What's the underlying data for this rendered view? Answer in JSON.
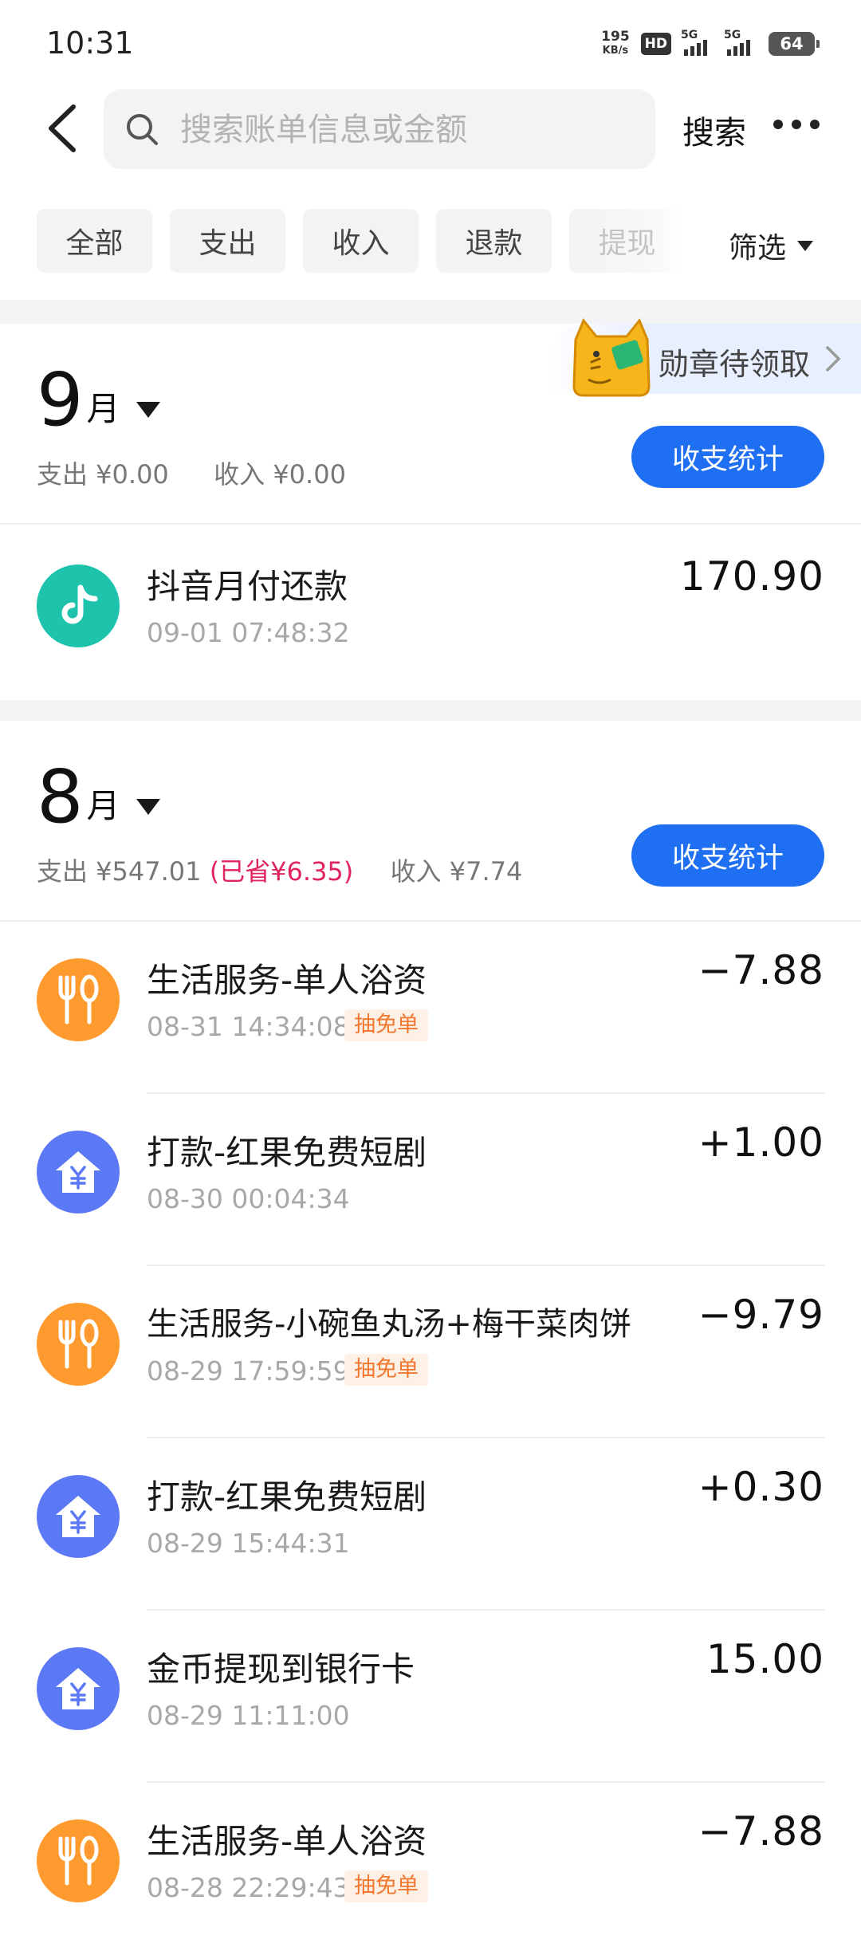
{
  "status_bar": {
    "time": "10:31",
    "net_speed_value": "195",
    "net_speed_unit": "KB/s",
    "hd_label": "HD",
    "sim1_label": "5G",
    "sim2_label": "5G",
    "battery": "64"
  },
  "header": {
    "search_placeholder": "搜索账单信息或金额",
    "search_label": "搜索"
  },
  "filters": {
    "tabs": [
      "全部",
      "支出",
      "收入",
      "退款",
      "提现"
    ],
    "filter_label": "筛选"
  },
  "badge_banner": {
    "label": "勋章待领取"
  },
  "months": [
    {
      "num": "9",
      "unit": "月",
      "expense": "支出 ¥0.00",
      "income": "收入 ¥0.00",
      "stat_label": "收支统计",
      "transactions": [
        {
          "icon": "douyin-icon",
          "title": "抖音月付还款",
          "time": "09-01 07:48:32",
          "amount": "170.90",
          "tag": ""
        }
      ]
    },
    {
      "num": "8",
      "unit": "月",
      "expense": "支出 ¥547.01",
      "saved": "(已省¥6.35)",
      "income": "收入 ¥7.74",
      "stat_label": "收支统计",
      "transactions": [
        {
          "icon": "fork-spoon-icon",
          "title": "生活服务-单人浴资",
          "time": "08-31 14:34:08",
          "amount": "−7.88",
          "tag": "抽免单"
        },
        {
          "icon": "yuan-house-icon",
          "title": "打款-红果免费短剧",
          "time": "08-30 00:04:34",
          "amount": "+1.00",
          "tag": ""
        },
        {
          "icon": "fork-spoon-icon",
          "title": "生活服务-小碗鱼丸汤+梅干菜肉饼",
          "time": "08-29 17:59:59",
          "amount": "−9.79",
          "tag": "抽免单"
        },
        {
          "icon": "yuan-house-icon",
          "title": "打款-红果免费短剧",
          "time": "08-29 15:44:31",
          "amount": "+0.30",
          "tag": ""
        },
        {
          "icon": "yuan-house-icon",
          "title": "金币提现到银行卡",
          "time": "08-29 11:11:00",
          "amount": "15.00",
          "tag": ""
        },
        {
          "icon": "fork-spoon-icon",
          "title": "生活服务-单人浴资",
          "time": "08-28 22:29:43",
          "amount": "−7.88",
          "tag": "抽免单"
        }
      ]
    }
  ],
  "colors": {
    "accent_blue": "#1f6ff2",
    "saved_red": "#e0245e",
    "orange_icon": "#ff9a2e",
    "blue_icon": "#5b79f5",
    "teal_icon": "#1ec3ac",
    "tag_orange": "#f0772d"
  }
}
